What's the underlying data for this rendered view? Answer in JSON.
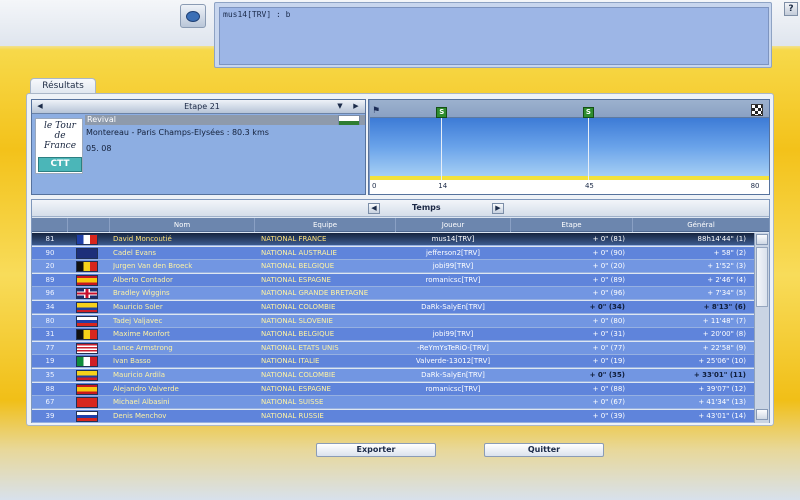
{
  "chat": {
    "text": "mus14[TRV] : b",
    "help_label": "?"
  },
  "tab": {
    "label": "Résultats"
  },
  "stage": {
    "title": "Etape 21",
    "prev_arrow": "◀",
    "dropdown_arrow": "▼",
    "next_arrow": "▶",
    "name": "Revival",
    "route": "Montereau - Paris Champs-Elysées : 80.3 kms",
    "date": "05. 08",
    "logo_text": "le Tour de France",
    "logo_badge": "CTT"
  },
  "profile": {
    "sprints": [
      {
        "label": "S",
        "km": 14
      },
      {
        "label": "S",
        "km": 45
      }
    ],
    "axis_labels": [
      "0",
      "14",
      "45",
      "80"
    ],
    "total_km": 80.3
  },
  "results": {
    "mode_label": "Temps",
    "mode_prev": "◀",
    "mode_next": "▶",
    "columns": {
      "name": "Nom",
      "team": "Equipe",
      "player": "Joueur",
      "stage": "Etape",
      "general": "Général"
    },
    "rows": [
      {
        "pos": "81",
        "flag": "fr",
        "name": "David Moncoutié",
        "team": "NATIONAL FRANCE",
        "player": "mus14[TRV]",
        "stage": "+ 0\" (81)",
        "general": "88h14'44\" (1)"
      },
      {
        "pos": "90",
        "flag": "au",
        "name": "Cadel Evans",
        "team": "NATIONAL AUSTRALIE",
        "player": "jefferson2[TRV]",
        "stage": "+ 0\" (90)",
        "general": "+ 58\" (2)"
      },
      {
        "pos": "20",
        "flag": "be",
        "name": "Jurgen Van den Broeck",
        "team": "NATIONAL BELGIQUE",
        "player": "jobi99[TRV]",
        "stage": "+ 0\" (20)",
        "general": "+ 1'52\" (3)"
      },
      {
        "pos": "89",
        "flag": "es",
        "name": "Alberto Contador",
        "team": "NATIONAL ESPAGNE",
        "player": "romanicsc[TRV]",
        "stage": "+ 0\" (89)",
        "general": "+ 2'46\" (4)"
      },
      {
        "pos": "96",
        "flag": "gb",
        "name": "Bradley Wiggins",
        "team": "NATIONAL GRANDE BRETAGNE",
        "player": "",
        "stage": "+ 0\" (96)",
        "general": "+ 7'34\" (5)"
      },
      {
        "pos": "34",
        "flag": "co",
        "name": "Mauricio Soler",
        "team": "NATIONAL COLOMBIE",
        "player": "DaRk-SalyEn[TRV]",
        "stage": "+ 0\" (34)",
        "general": "+ 8'13\" (6)"
      },
      {
        "pos": "80",
        "flag": "si",
        "name": "Tadej Valjavec",
        "team": "NATIONAL SLOVENIE",
        "player": "",
        "stage": "+ 0\" (80)",
        "general": "+ 11'48\" (7)"
      },
      {
        "pos": "31",
        "flag": "be",
        "name": "Maxime Monfort",
        "team": "NATIONAL BELGIQUE",
        "player": "jobi99[TRV]",
        "stage": "+ 0\" (31)",
        "general": "+ 20'00\" (8)"
      },
      {
        "pos": "77",
        "flag": "us",
        "name": "Lance Armstrong",
        "team": "NATIONAL ETATS UNIS",
        "player": "-ReYmYsTeRiO-[TRV]",
        "stage": "+ 0\" (77)",
        "general": "+ 22'58\" (9)"
      },
      {
        "pos": "19",
        "flag": "it",
        "name": "Ivan Basso",
        "team": "NATIONAL ITALIE",
        "player": "Valverde-13012[TRV]",
        "stage": "+ 0\" (19)",
        "general": "+ 25'06\" (10)"
      },
      {
        "pos": "35",
        "flag": "co",
        "name": "Mauricio Ardila",
        "team": "NATIONAL COLOMBIE",
        "player": "DaRk-SalyEn[TRV]",
        "stage": "+ 0\" (35)",
        "general": "+ 33'01\" (11)"
      },
      {
        "pos": "88",
        "flag": "es",
        "name": "Alejandro Valverde",
        "team": "NATIONAL ESPAGNE",
        "player": "romanicsc[TRV]",
        "stage": "+ 0\" (88)",
        "general": "+ 39'07\" (12)"
      },
      {
        "pos": "67",
        "flag": "ch",
        "name": "Michael Albasini",
        "team": "NATIONAL SUISSE",
        "player": "",
        "stage": "+ 0\" (67)",
        "general": "+ 41'34\" (13)"
      },
      {
        "pos": "39",
        "flag": "ru",
        "name": "Denis Menchov",
        "team": "NATIONAL RUSSIE",
        "player": "",
        "stage": "+ 0\" (39)",
        "general": "+ 43'01\" (14)"
      }
    ]
  },
  "buttons": {
    "export": "Exporter",
    "quit": "Quitter"
  }
}
